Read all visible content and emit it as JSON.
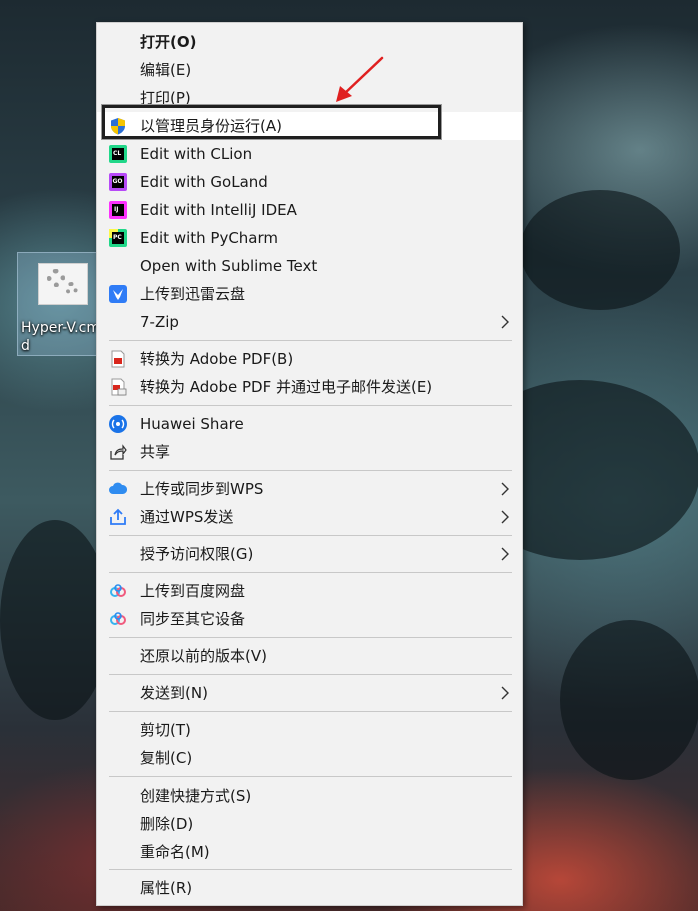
{
  "desktop": {
    "icon_label": "Hyper-V.cmd"
  },
  "menu": {
    "items": [
      {
        "label": "打开(O)",
        "icon": ""
      },
      {
        "label": "编辑(E)",
        "icon": ""
      },
      {
        "label": "打印(P)",
        "icon": ""
      },
      {
        "label": "以管理员身份运行(A)",
        "icon": "uac-shield-icon"
      },
      {
        "label": "Edit with CLion",
        "icon": "clion-icon"
      },
      {
        "label": "Edit with GoLand",
        "icon": "goland-icon"
      },
      {
        "label": "Edit with IntelliJ IDEA",
        "icon": "intellij-icon"
      },
      {
        "label": "Edit with PyCharm",
        "icon": "pycharm-icon"
      },
      {
        "label": "Open with Sublime Text",
        "icon": ""
      },
      {
        "label": "上传到迅雷云盘",
        "icon": "thunder-cloud-icon"
      },
      {
        "label": "7-Zip",
        "icon": "",
        "submenu": true
      },
      {
        "label": "转换为 Adobe PDF(B)",
        "icon": "adobe-pdf-icon"
      },
      {
        "label": "转换为 Adobe PDF 并通过电子邮件发送(E)",
        "icon": "adobe-pdf-email-icon"
      },
      {
        "label": "Huawei Share",
        "icon": "huawei-share-icon"
      },
      {
        "label": "共享",
        "icon": "share-icon"
      },
      {
        "label": "上传或同步到WPS",
        "icon": "wps-cloud-icon",
        "submenu": true
      },
      {
        "label": "通过WPS发送",
        "icon": "wps-send-icon",
        "submenu": true
      },
      {
        "label": "授予访问权限(G)",
        "icon": "",
        "submenu": true
      },
      {
        "label": "上传到百度网盘",
        "icon": "baidu-netdisk-icon"
      },
      {
        "label": "同步至其它设备",
        "icon": "baidu-sync-icon"
      },
      {
        "label": "还原以前的版本(V)",
        "icon": ""
      },
      {
        "label": "发送到(N)",
        "icon": "",
        "submenu": true
      },
      {
        "label": "剪切(T)",
        "icon": ""
      },
      {
        "label": "复制(C)",
        "icon": ""
      },
      {
        "label": "创建快捷方式(S)",
        "icon": ""
      },
      {
        "label": "删除(D)",
        "icon": ""
      },
      {
        "label": "重命名(M)",
        "icon": ""
      },
      {
        "label": "属性(R)",
        "icon": ""
      }
    ],
    "jetbrains_codes": {
      "clion": "CL",
      "goland": "GO",
      "intellij": "IJ",
      "pycharm": "PC"
    }
  },
  "colors": {
    "menu_background": "#f2f2f2",
    "annotation_arrow": "#e02020",
    "highlight_border": "#1f1f1f"
  }
}
